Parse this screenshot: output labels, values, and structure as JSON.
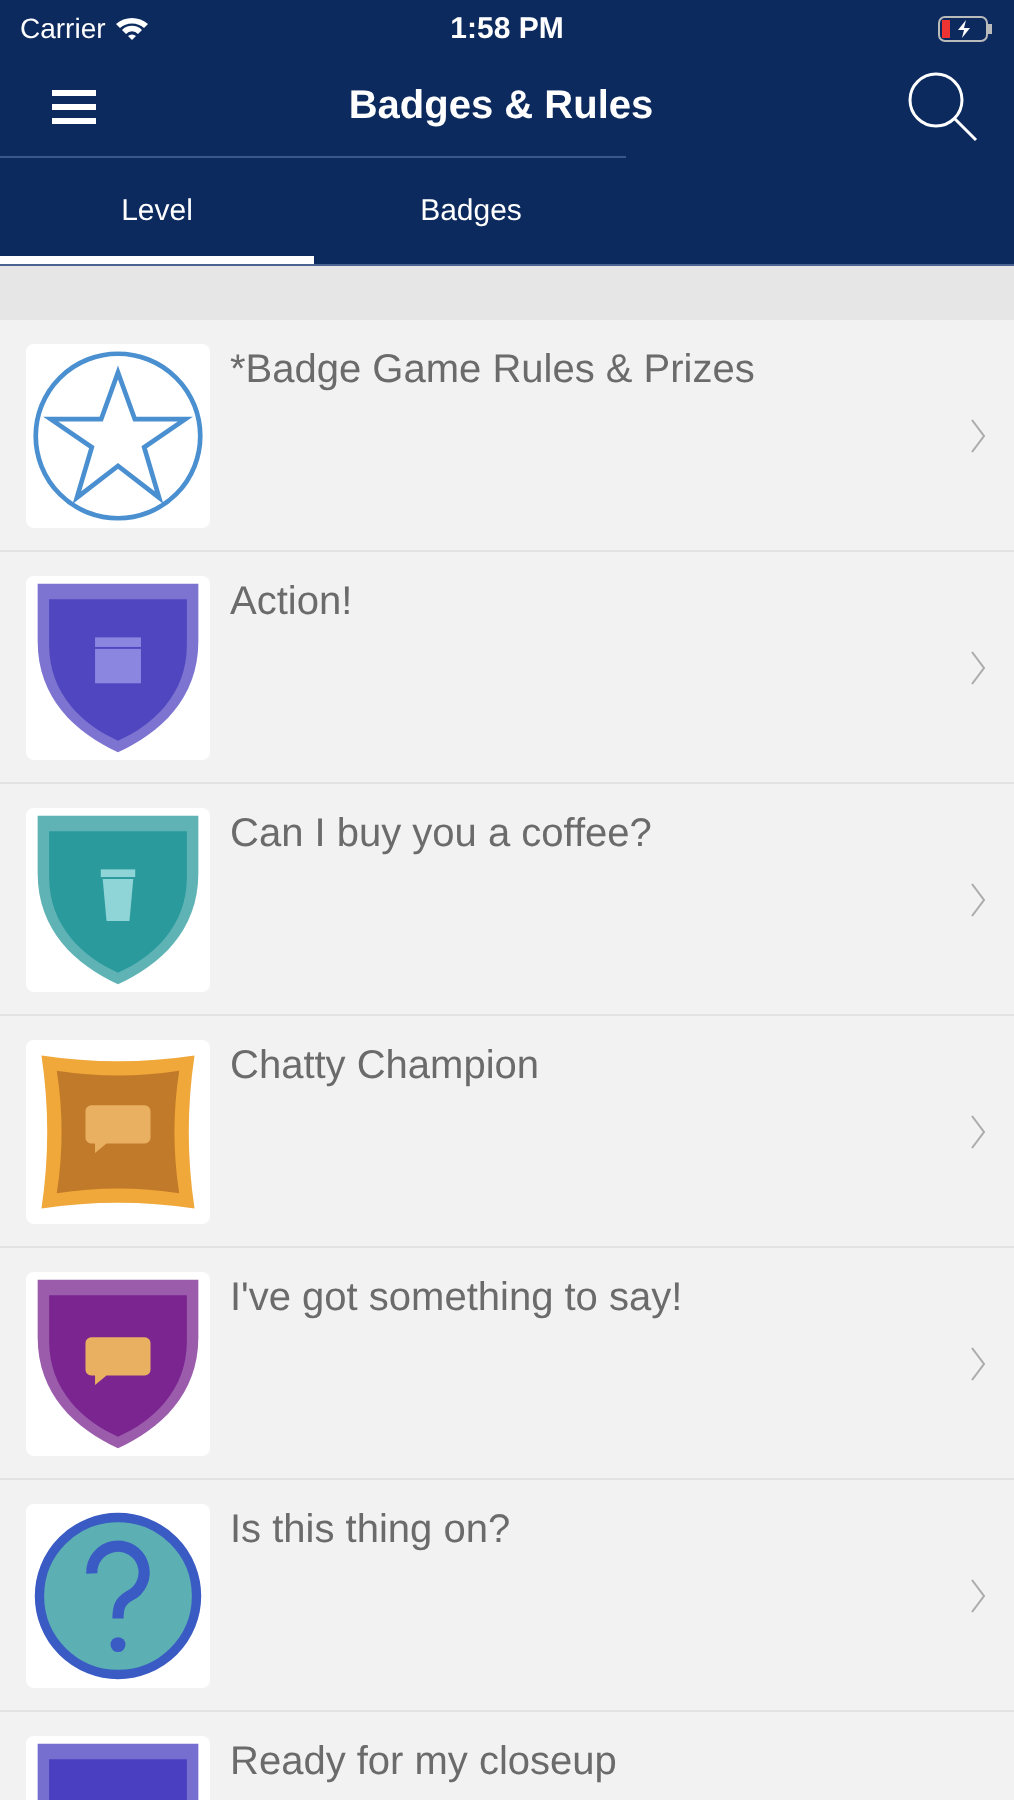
{
  "status_bar": {
    "carrier": "Carrier",
    "time": "1:58 PM"
  },
  "nav": {
    "title": "Badges & Rules"
  },
  "tabs": [
    {
      "label": "Level",
      "selected": true
    },
    {
      "label": "Badges",
      "selected": false
    }
  ],
  "rows": [
    {
      "title": "*Badge Game Rules & Prizes",
      "badge": {
        "kind": "star",
        "color": "#4a8fd0"
      }
    },
    {
      "title": "Action!",
      "badge": {
        "kind": "shield",
        "color": "#5046c0",
        "emblem": {
          "kind": "clapper"
        }
      }
    },
    {
      "title": "Can I buy you a coffee?",
      "badge": {
        "kind": "shield",
        "color": "#2a9a9c",
        "emblem": {
          "kind": "cup"
        }
      }
    },
    {
      "title": "Chatty Champion",
      "badge": {
        "kind": "cushion",
        "color": "#c07a2a",
        "emblem": {
          "kind": "chat"
        }
      }
    },
    {
      "title": "I've got something to say!",
      "badge": {
        "kind": "shield",
        "color": "#7a2590",
        "emblem": {
          "kind": "chat"
        }
      }
    },
    {
      "title": "Is this thing on?",
      "badge": {
        "kind": "question",
        "color": "#5cb0b4"
      }
    },
    {
      "title": "Ready for my closeup",
      "badge": {
        "kind": "shield",
        "color": "#4a3fc0"
      }
    }
  ]
}
